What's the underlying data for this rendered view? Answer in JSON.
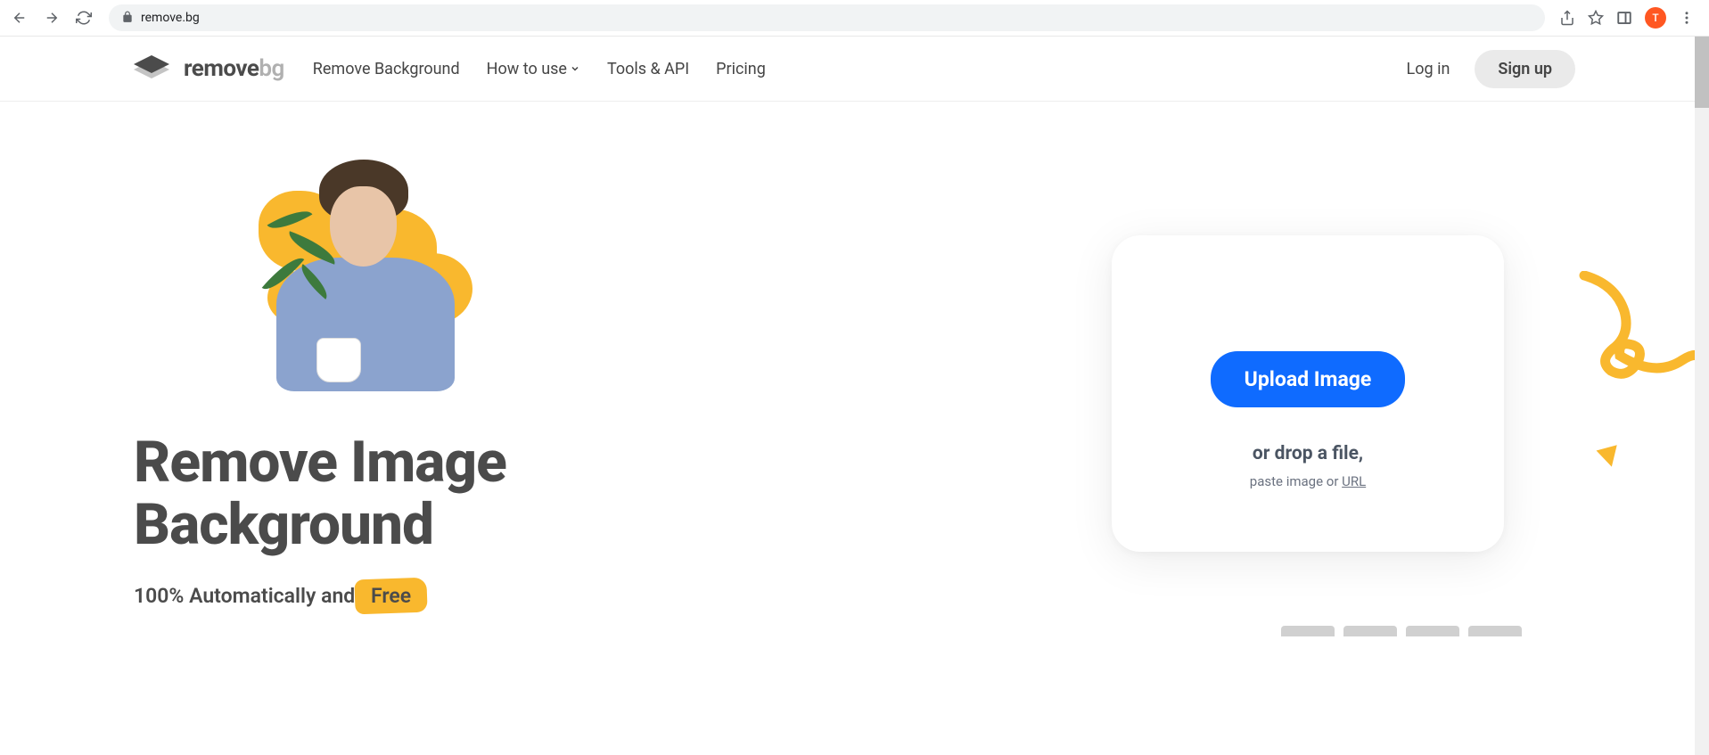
{
  "browser": {
    "url": "remove.bg",
    "avatar_letter": "T"
  },
  "logo": {
    "part1": "remove",
    "part2": "bg"
  },
  "nav": {
    "items": [
      {
        "label": "Remove Background",
        "has_dropdown": false
      },
      {
        "label": "How to use",
        "has_dropdown": true
      },
      {
        "label": "Tools & API",
        "has_dropdown": false
      },
      {
        "label": "Pricing",
        "has_dropdown": false
      }
    ],
    "login": "Log in",
    "signup": "Sign up"
  },
  "hero": {
    "title_line1": "Remove Image",
    "title_line2": "Background",
    "subtitle_prefix": "100% Automatically and",
    "subtitle_highlight": "Free"
  },
  "upload": {
    "button": "Upload Image",
    "drop_text": "or drop a file,",
    "paste_prefix": "paste image or ",
    "url_label": "URL"
  }
}
